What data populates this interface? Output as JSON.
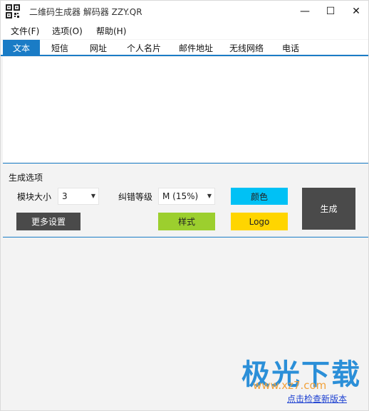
{
  "window": {
    "title": "二维码生成器 解码器 ZZY.QR",
    "controls": {
      "minimize": "—",
      "maximize": "☐",
      "close": "✕"
    }
  },
  "menu": {
    "items": [
      "文件(F)",
      "选项(O)",
      "帮助(H)"
    ]
  },
  "tabs": {
    "items": [
      "文本",
      "短信",
      "网址",
      "个人名片",
      "邮件地址",
      "无线网络",
      "电话"
    ],
    "active": "文本"
  },
  "editor": {
    "value": ""
  },
  "options": {
    "section_title": "生成选项",
    "module_size_label": "模块大小",
    "module_size_value": "3",
    "error_level_label": "纠错等级",
    "error_level_value": "M (15%)"
  },
  "buttons": {
    "color": "颜色",
    "style": "样式",
    "logo": "Logo",
    "more_settings": "更多设置",
    "generate": "生成"
  },
  "footer": {
    "watermark": "极光下载",
    "watermark_url": "www.xz7.com",
    "update_link": "点击检查新版本"
  },
  "colors": {
    "accent": "#1a7cc6",
    "color_button": "#00c1f5",
    "style_button": "#9ccf2e",
    "logo_button": "#ffd500",
    "dark_button": "#4a4a4a"
  }
}
